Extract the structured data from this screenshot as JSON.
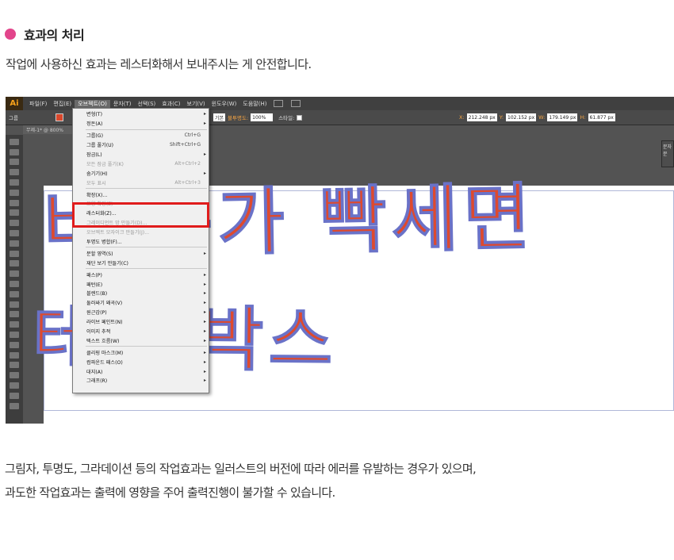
{
  "heading": {
    "title": "효과의 처리",
    "dot_color": "#e2458b"
  },
  "subtitle": "작업에 사용하신 효과는 레스터화해서 보내주시는 게 안전합니다.",
  "screenshot": {
    "app_logo": "Ai",
    "menubar": [
      "파일(F)",
      "편집(E)",
      "오브젝트(O)",
      "문자(T)",
      "선택(S)",
      "효과(C)",
      "보기(V)",
      "윈도우(W)",
      "도움말(H)"
    ],
    "active_menu": "오브젝트(O)",
    "control_bar": {
      "object_label": "그룹",
      "basic_label": "기본",
      "opacity_label": "불투명도:",
      "opacity_value": "100%",
      "style_label": "스타일:",
      "x_label": "X:",
      "x_value": "212.248 px",
      "y_label": "Y:",
      "y_value": "102.152 px",
      "w_label": "W:",
      "w_value": "179.149 px",
      "h_label": "H:",
      "h_value": "61.877 px"
    },
    "doc_tab": "무제-1* @ 800%",
    "right_panel": [
      "문자",
      "문"
    ],
    "artwork": {
      "line1": "바 는가 빡세면",
      "line2": "테이 박스",
      "fill_color": "#de4a2e",
      "path_color": "#6a72c8"
    },
    "dropdown": [
      {
        "label": "변형(T)",
        "shortcut": "",
        "sub": true,
        "disabled": false
      },
      {
        "label": "정돈(A)",
        "shortcut": "",
        "sub": true,
        "disabled": false
      },
      {
        "sep": true
      },
      {
        "label": "그룹(G)",
        "shortcut": "Ctrl+G",
        "sub": false,
        "disabled": false
      },
      {
        "label": "그룹 풀기(U)",
        "shortcut": "Shift+Ctrl+G",
        "sub": false,
        "disabled": false
      },
      {
        "label": "잠금(L)",
        "shortcut": "",
        "sub": true,
        "disabled": false
      },
      {
        "label": "모든 잠금 풀기(K)",
        "shortcut": "Alt+Ctrl+2",
        "sub": false,
        "disabled": true
      },
      {
        "label": "숨기기(H)",
        "shortcut": "",
        "sub": true,
        "disabled": false
      },
      {
        "label": "모두 표시",
        "shortcut": "Alt+Ctrl+3",
        "sub": false,
        "disabled": true
      },
      {
        "sep": true
      },
      {
        "label": "확장(X)...",
        "shortcut": "",
        "sub": false,
        "disabled": false
      },
      {
        "label": "모양 확장(E)",
        "shortcut": "",
        "sub": false,
        "disabled": true
      },
      {
        "label": "래스터화(Z)...",
        "shortcut": "",
        "sub": false,
        "disabled": false
      },
      {
        "label": "그레이디언트 망 만들기(D)...",
        "shortcut": "",
        "sub": false,
        "disabled": true
      },
      {
        "label": "오브젝트 모자이크 만들기(J)...",
        "shortcut": "",
        "sub": false,
        "disabled": true
      },
      {
        "label": "투명도 병합(F)...",
        "shortcut": "",
        "sub": false,
        "disabled": false
      },
      {
        "sep": true
      },
      {
        "label": "분할 영역(S)",
        "shortcut": "",
        "sub": true,
        "disabled": false
      },
      {
        "label": "재단 보기 만들기(C)",
        "shortcut": "",
        "sub": false,
        "disabled": false
      },
      {
        "sep": true
      },
      {
        "label": "패스(P)",
        "shortcut": "",
        "sub": true,
        "disabled": false
      },
      {
        "label": "패턴(E)",
        "shortcut": "",
        "sub": true,
        "disabled": false
      },
      {
        "label": "블렌드(B)",
        "shortcut": "",
        "sub": true,
        "disabled": false
      },
      {
        "label": "둘러싸기 왜곡(V)",
        "shortcut": "",
        "sub": true,
        "disabled": false
      },
      {
        "label": "원근감(P)",
        "shortcut": "",
        "sub": true,
        "disabled": false
      },
      {
        "label": "라이브 페인트(N)",
        "shortcut": "",
        "sub": true,
        "disabled": false
      },
      {
        "label": "이미지 추적",
        "shortcut": "",
        "sub": true,
        "disabled": false
      },
      {
        "label": "텍스트 흐름(W)",
        "shortcut": "",
        "sub": true,
        "disabled": false
      },
      {
        "sep": true
      },
      {
        "label": "클리핑 마스크(M)",
        "shortcut": "",
        "sub": true,
        "disabled": false
      },
      {
        "label": "컴파운드 패스(O)",
        "shortcut": "",
        "sub": true,
        "disabled": false
      },
      {
        "label": "대지(A)",
        "shortcut": "",
        "sub": true,
        "disabled": false
      },
      {
        "label": "그래프(R)",
        "shortcut": "",
        "sub": true,
        "disabled": false
      }
    ]
  },
  "body": {
    "line1": "그림자, 투명도, 그라데이션 등의 작업효과는 일러스트의 버전에 따라 에러를 유발하는 경우가 있으며,",
    "line2": "과도한 작업효과는 출력에 영향을 주어 출력진행이 불가할 수 있습니다."
  }
}
